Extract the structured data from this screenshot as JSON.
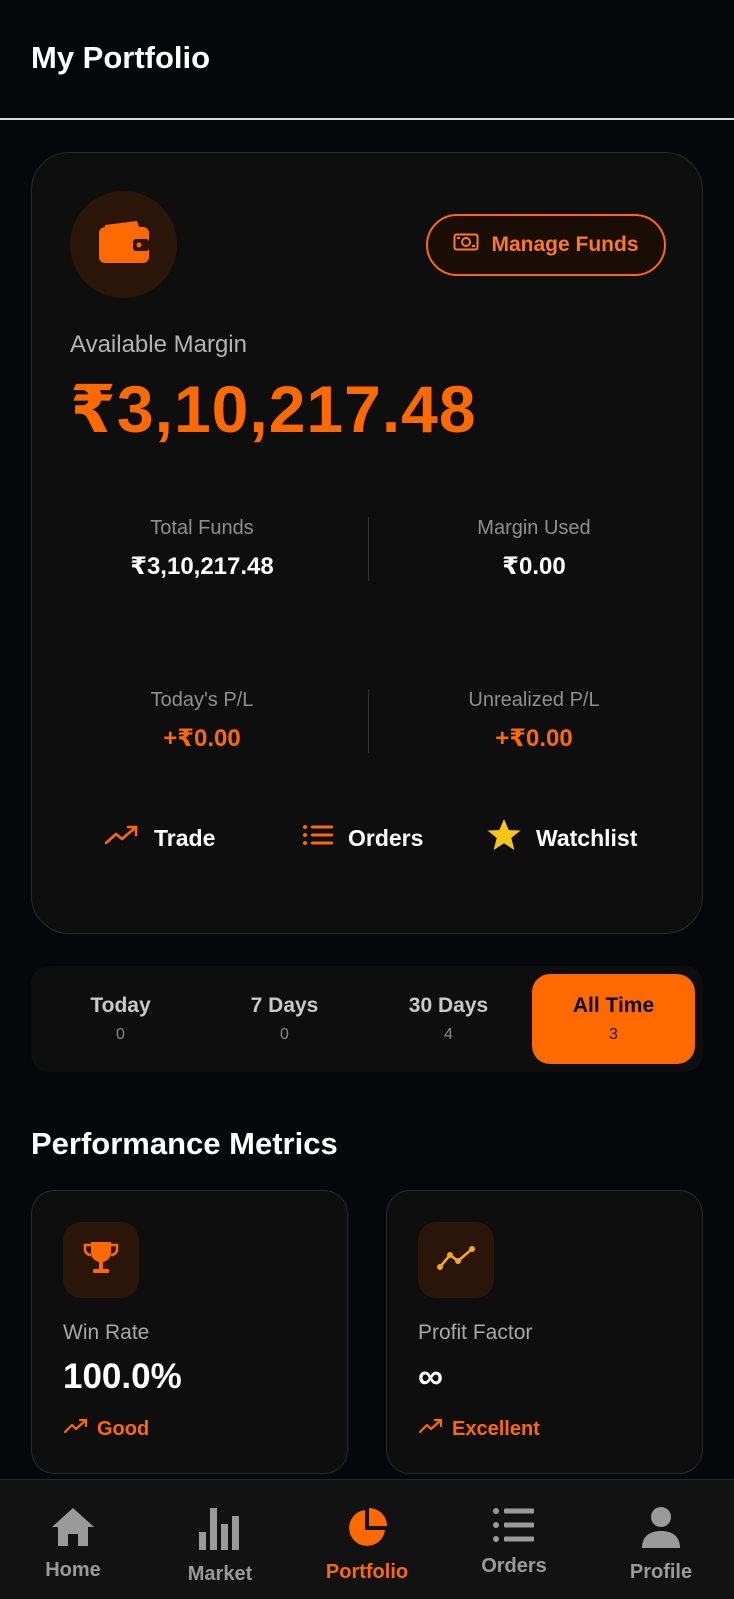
{
  "header": {
    "title": "My Portfolio"
  },
  "card": {
    "wallet_icon": "wallet-icon",
    "manage_funds_label": "Manage Funds",
    "available_margin_label": "Available Margin",
    "available_margin_value": "₹3,10,217.48",
    "stats": [
      {
        "label": "Total Funds",
        "value": "₹3,10,217.48"
      },
      {
        "label": "Margin Used",
        "value": "₹0.00"
      },
      {
        "label": "Today's P/L",
        "value": "+₹0.00"
      },
      {
        "label": "Unrealized P/L",
        "value": "+₹0.00"
      }
    ],
    "actions": [
      {
        "label": "Trade",
        "icon": "trending-up-icon"
      },
      {
        "label": "Orders",
        "icon": "list-icon"
      },
      {
        "label": "Watchlist",
        "icon": "star-icon"
      }
    ]
  },
  "tabs": [
    {
      "label": "Today",
      "count": "0"
    },
    {
      "label": "7 Days",
      "count": "0"
    },
    {
      "label": "30 Days",
      "count": "4"
    },
    {
      "label": "All Time",
      "count": "3",
      "active": true
    }
  ],
  "performance": {
    "title": "Performance Metrics",
    "metrics": [
      {
        "label": "Win Rate",
        "value": "100.0%",
        "tag": "Good",
        "icon": "trophy-icon"
      },
      {
        "label": "Profit Factor",
        "value": "∞",
        "tag": "Excellent",
        "icon": "line-chart-icon"
      }
    ]
  },
  "bottom_nav": [
    {
      "label": "Home",
      "icon": "home-icon"
    },
    {
      "label": "Market",
      "icon": "bar-chart-icon"
    },
    {
      "label": "Portfolio",
      "icon": "pie-chart-icon",
      "active": true
    },
    {
      "label": "Orders",
      "icon": "list-icon"
    },
    {
      "label": "Profile",
      "icon": "user-icon"
    }
  ],
  "colors": {
    "accent": "#ff6a00",
    "background": "#05070a",
    "card": "#0e0e0e",
    "star": "#f5c518"
  }
}
